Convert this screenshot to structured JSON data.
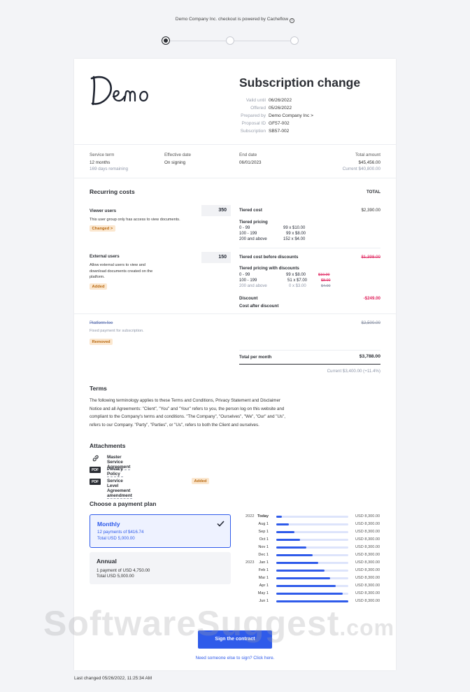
{
  "top_note": "Demo Company Inc. checkout is powered by Cacheflow",
  "stepper": {
    "steps": 3,
    "active": 1
  },
  "header": {
    "logo_text": "Demo",
    "title": "Subscription change",
    "meta": [
      {
        "key": "Valid until",
        "value": "06/26/2022"
      },
      {
        "key": "Offered",
        "value": "05/26/2022"
      },
      {
        "key": "Prepared by",
        "value": "Demo Company Inc >"
      },
      {
        "key": "Proposal ID",
        "value": "GF57-002"
      },
      {
        "key": "Subscription",
        "value": "SB57-002"
      }
    ]
  },
  "summary": {
    "service_term": {
      "label": "Service term",
      "value": "12 months",
      "sub": "169 days remaining"
    },
    "effective_date": {
      "label": "Effective date",
      "value": "On signing"
    },
    "end_date": {
      "label": "End date",
      "value": "06/01/2023"
    },
    "total_amount": {
      "label": "Total amount",
      "value": "$45,456.00",
      "sub": "Current $40,800.00"
    }
  },
  "recurring": {
    "title": "Recurring costs",
    "total_header": "TOTAL",
    "viewer": {
      "name": "Viewer users",
      "desc": "This user group only has access to view documents.",
      "badge": "Changed >",
      "qty": "350",
      "tiered_cost_label": "Tiered cost",
      "tiered_cost_value": "$2,390.00",
      "tiered_pricing_label": "Tiered pricing",
      "tiers": [
        {
          "range": "0 - 99",
          "calc": "99 x $10.00"
        },
        {
          "range": "100 - 199",
          "calc": "99 x $8.00"
        },
        {
          "range": "200 and above",
          "calc": "152 x $4.00"
        }
      ]
    },
    "external": {
      "name": "External users",
      "desc": "Allow external users to view and download documents created on the platform.",
      "badge": "Added",
      "qty": "150",
      "before_label": "Tiered cost before discounts",
      "before_value": "$1,398.00",
      "with_discounts_label": "Tiered pricing with discounts",
      "tiers": [
        {
          "range": "0 - 99",
          "calc": "99 x $8.00",
          "old": "$10.00"
        },
        {
          "range": "100 - 199",
          "calc": "51 x $7.00",
          "old": "$8.00"
        },
        {
          "range": "200 and above",
          "calc": "0 x $3.00",
          "old": "$4.00"
        }
      ],
      "discount_label": "Discount",
      "discount_value": "-$249.00",
      "after_label": "Cost after discount"
    },
    "platform": {
      "name": "Platform fee",
      "desc": "Fixed payment for subscription.",
      "badge": "Removed",
      "value": "$2,500.00"
    },
    "total_label": "Total per month",
    "total_value": "$3,788.00",
    "current": "Current $3,400.00 (+11.4%)"
  },
  "terms": {
    "title": "Terms",
    "lines": [
      "The following terminology applies to these Terms and Conditions, Privacy Statement and Disclaimer",
      "Notice and all Agreements: \"Client\", \"You\" and \"Your\" refers to you, the person log on this website and",
      "compliant to the Company's terms and conditions. \"The Company\", \"Ourselves\", \"We\", \"Our\" and \"Us\",",
      "refers to our Company. \"Party\", \"Parties\", or \"Us\", refers to both the Client and ourselves."
    ]
  },
  "attachments": {
    "title": "Attachments",
    "items": [
      {
        "type": "link",
        "name": "Master Service Agreement"
      },
      {
        "type": "PDF",
        "name": "Privacy Policy"
      },
      {
        "type": "PDF",
        "name": "Service Level Agreement amendment",
        "badge": "Added"
      }
    ]
  },
  "payment": {
    "title": "Choose a payment plan",
    "plans": [
      {
        "name": "Monthly",
        "line1": "12 payments of $416.74",
        "line2": "Total USD 5,000.00",
        "selected": true
      },
      {
        "name": "Annual",
        "line1": "1 payment of USD 4,750.00",
        "line2": "Total USD 5,000.00",
        "selected": false
      }
    ],
    "schedule": [
      {
        "year": "2022",
        "date": "Today",
        "progress": 0.08,
        "amount": "USD 8,300.00"
      },
      {
        "year": "",
        "date": "Aug 1",
        "progress": 0.17,
        "amount": "USD 8,300.00"
      },
      {
        "year": "",
        "date": "Sep 1",
        "progress": 0.25,
        "amount": "USD 8,300.00"
      },
      {
        "year": "",
        "date": "Oct 1",
        "progress": 0.33,
        "amount": "USD 8,300.00"
      },
      {
        "year": "",
        "date": "Nov 1",
        "progress": 0.42,
        "amount": "USD 8,300.00"
      },
      {
        "year": "",
        "date": "Dec 1",
        "progress": 0.5,
        "amount": "USD 8,300.00"
      },
      {
        "year": "2023",
        "date": "Jan 1",
        "progress": 0.58,
        "amount": "USD 8,300.00"
      },
      {
        "year": "",
        "date": "Feb 1",
        "progress": 0.67,
        "amount": "USD 8,300.00"
      },
      {
        "year": "",
        "date": "Mar 1",
        "progress": 0.75,
        "amount": "USD 8,300.00"
      },
      {
        "year": "",
        "date": "Apr 1",
        "progress": 0.83,
        "amount": "USD 8,300.00"
      },
      {
        "year": "",
        "date": "May 1",
        "progress": 0.92,
        "amount": "USD 8,300.00"
      },
      {
        "year": "",
        "date": "Jun 1",
        "progress": 1.0,
        "amount": "USD 8,300.00"
      }
    ]
  },
  "sign_button": "Sign the contract",
  "other_signer_link": "Need someone else to sign? Click here.",
  "watermark": {
    "main": "SoftwareSuggest",
    "suffix": ".com"
  },
  "footer": "Last changed 05/26/2022, 11:25:34 AM",
  "colors": {
    "accent": "#2f5bea",
    "danger": "#e0245e",
    "badge_bg": "#fbe7cf",
    "badge_text": "#b96a12"
  }
}
